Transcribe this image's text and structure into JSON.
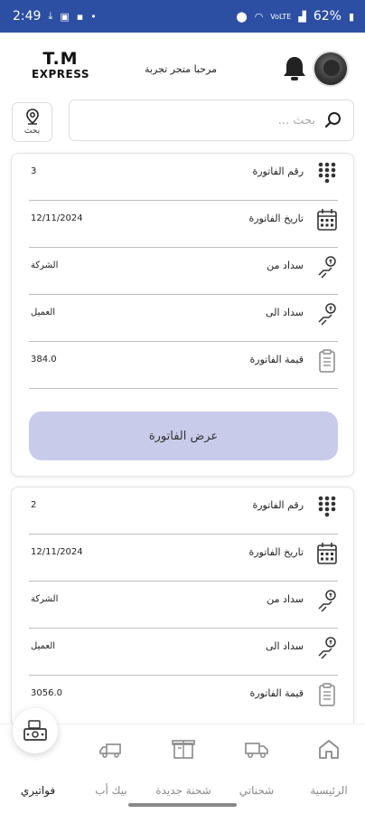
{
  "status_bar": {
    "time": "2:49",
    "battery": "62%",
    "network": "VoLTE"
  },
  "header": {
    "logo_line1": "T.M",
    "logo_line2": "EXPRESS",
    "welcome_text": "مرحبا متجر تجربة"
  },
  "filter": {
    "label": "بحث"
  },
  "search": {
    "placeholder": "بحث ..."
  },
  "invoices": [
    {
      "number_label": "رقم الفاتورة",
      "number": "3",
      "date_label": "تاريخ الفاتورة",
      "date": "12/11/2024",
      "paid_from_label": "سداد من",
      "paid_from": "الشركة",
      "paid_to_label": "سداد الى",
      "paid_to": "العميل",
      "amount_label": "قيمة الفاتورة",
      "amount": "384.0",
      "view_button": "عرض الفاتورة"
    },
    {
      "number_label": "رقم الفاتورة",
      "number": "2",
      "date_label": "تاريخ الفاتورة",
      "date": "12/11/2024",
      "paid_from_label": "سداد من",
      "paid_from": "الشركة",
      "paid_to_label": "سداد الى",
      "paid_to": "العميل",
      "amount_label": "قيمة الفاتورة",
      "amount": "3056.0"
    }
  ],
  "bottom_nav": {
    "home": "الرئيسية",
    "my_shipments": "شحناتي",
    "new_shipment": "شحنة جديدة",
    "pickup": "بيك أب",
    "invoices": "فواتيري",
    "active_item": "invoices"
  },
  "colors": {
    "status_bar": "#2c4fa3",
    "button_bg": "#c9cbea",
    "nav_inactive": "#8a8a8a"
  }
}
